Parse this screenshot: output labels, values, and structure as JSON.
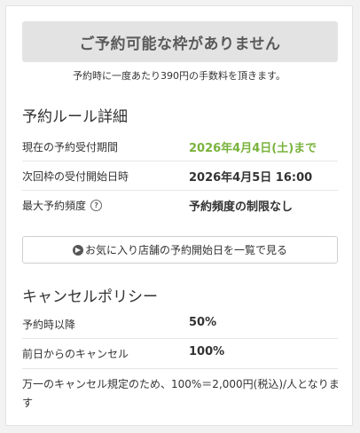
{
  "reservation": {
    "unavailable_label": "ご予約可能な枠がありません",
    "fee_note": "予約時に一度あたり390円の手数料を頂きます。"
  },
  "rules": {
    "title": "予約ルール詳細",
    "rows": [
      {
        "label": "現在の予約受付期間",
        "value": "2026年4月4日(土)まで"
      },
      {
        "label": "次回枠の受付開始日時",
        "value": "2026年4月5日 16:00"
      },
      {
        "label": "最大予約頻度",
        "value": "予約頻度の制限なし"
      }
    ],
    "help_icon": "?"
  },
  "favorites_button": {
    "icon": "circle-arrow-right-icon",
    "label": "お気に入り店舗の予約開始日を一覧で見る"
  },
  "cancel_policy": {
    "title": "キャンセルポリシー",
    "rows": [
      {
        "label": "予約時以降",
        "value": "50%"
      },
      {
        "label": "前日からのキャンセル",
        "value": "100%"
      }
    ],
    "note": "万一のキャンセル規定のため、100%＝2,000円(税込)/人となります"
  },
  "colors": {
    "accent_green": "#7ab33d",
    "disabled_button_bg": "#e3e3e3"
  }
}
